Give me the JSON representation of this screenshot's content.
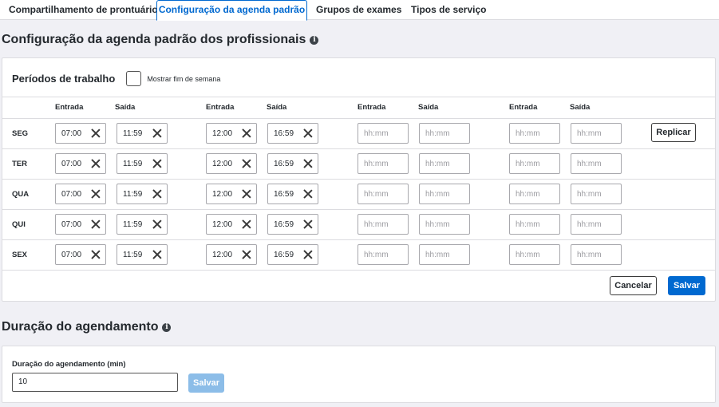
{
  "tabs": [
    {
      "label": "Compartilhamento de prontuário"
    },
    {
      "label": "Configuração da agenda padrão"
    },
    {
      "label": "Grupos de exames"
    },
    {
      "label": "Tipos de serviço"
    }
  ],
  "schedule": {
    "title": "Configuração da agenda padrão dos profissionais",
    "periods_label": "Períodos de trabalho",
    "weekend_label": "Mostrar fim de semana",
    "weekend_checked": false,
    "headers": [
      "Entrada",
      "Saída",
      "Entrada",
      "Saída",
      "Entrada",
      "Saída",
      "Entrada",
      "Saída"
    ],
    "placeholder": "hh:mm",
    "rows": [
      {
        "day": "SEG",
        "times": [
          "07:00",
          "11:59",
          "12:00",
          "16:59",
          "",
          "",
          "",
          ""
        ]
      },
      {
        "day": "TER",
        "times": [
          "07:00",
          "11:59",
          "12:00",
          "16:59",
          "",
          "",
          "",
          ""
        ]
      },
      {
        "day": "QUA",
        "times": [
          "07:00",
          "11:59",
          "12:00",
          "16:59",
          "",
          "",
          "",
          ""
        ]
      },
      {
        "day": "QUI",
        "times": [
          "07:00",
          "11:59",
          "12:00",
          "16:59",
          "",
          "",
          "",
          ""
        ]
      },
      {
        "day": "SEX",
        "times": [
          "07:00",
          "11:59",
          "12:00",
          "16:59",
          "",
          "",
          "",
          ""
        ]
      }
    ],
    "replicate_label": "Replicar",
    "cancel_label": "Cancelar",
    "save_label": "Salvar"
  },
  "duration": {
    "title": "Duração do agendamento",
    "field_label": "Duração do agendamento (min)",
    "value": "10",
    "save_label": "Salvar"
  },
  "colors": {
    "primary": "#0069d0",
    "primary_disabled": "#8cbde8",
    "background": "#f0f0f5"
  }
}
